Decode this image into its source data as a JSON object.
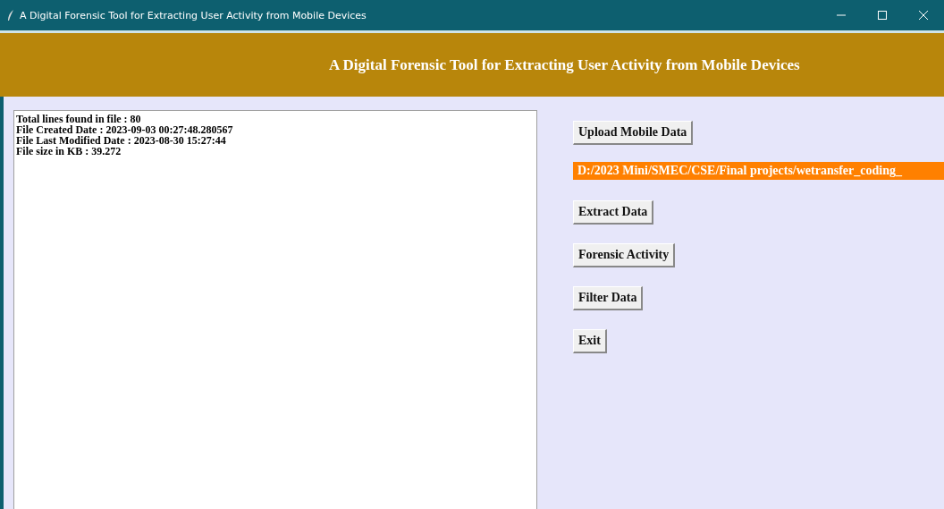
{
  "window": {
    "title": "A Digital Forensic Tool for Extracting User Activity from Mobile Devices"
  },
  "header": {
    "title": "A Digital Forensic Tool for Extracting User Activity from Mobile Devices"
  },
  "output": {
    "lines": [
      "Total lines found in file : 80",
      "File Created Date : 2023-09-03 00:27:48.280567",
      "File Last Modified Date : 2023-08-30 15:27:44",
      "File size in KB : 39.272"
    ]
  },
  "controls": [
    {
      "kind": "button",
      "label": "Upload Mobile Data"
    },
    {
      "kind": "path",
      "label": "D:/2023 Mini/SMEC/CSE/Final projects/wetransfer_coding_"
    },
    {
      "kind": "button",
      "label": "Extract Data"
    },
    {
      "kind": "button",
      "label": "Forensic Activity"
    },
    {
      "kind": "button",
      "label": "Filter Data"
    },
    {
      "kind": "button",
      "label": "Exit"
    }
  ]
}
